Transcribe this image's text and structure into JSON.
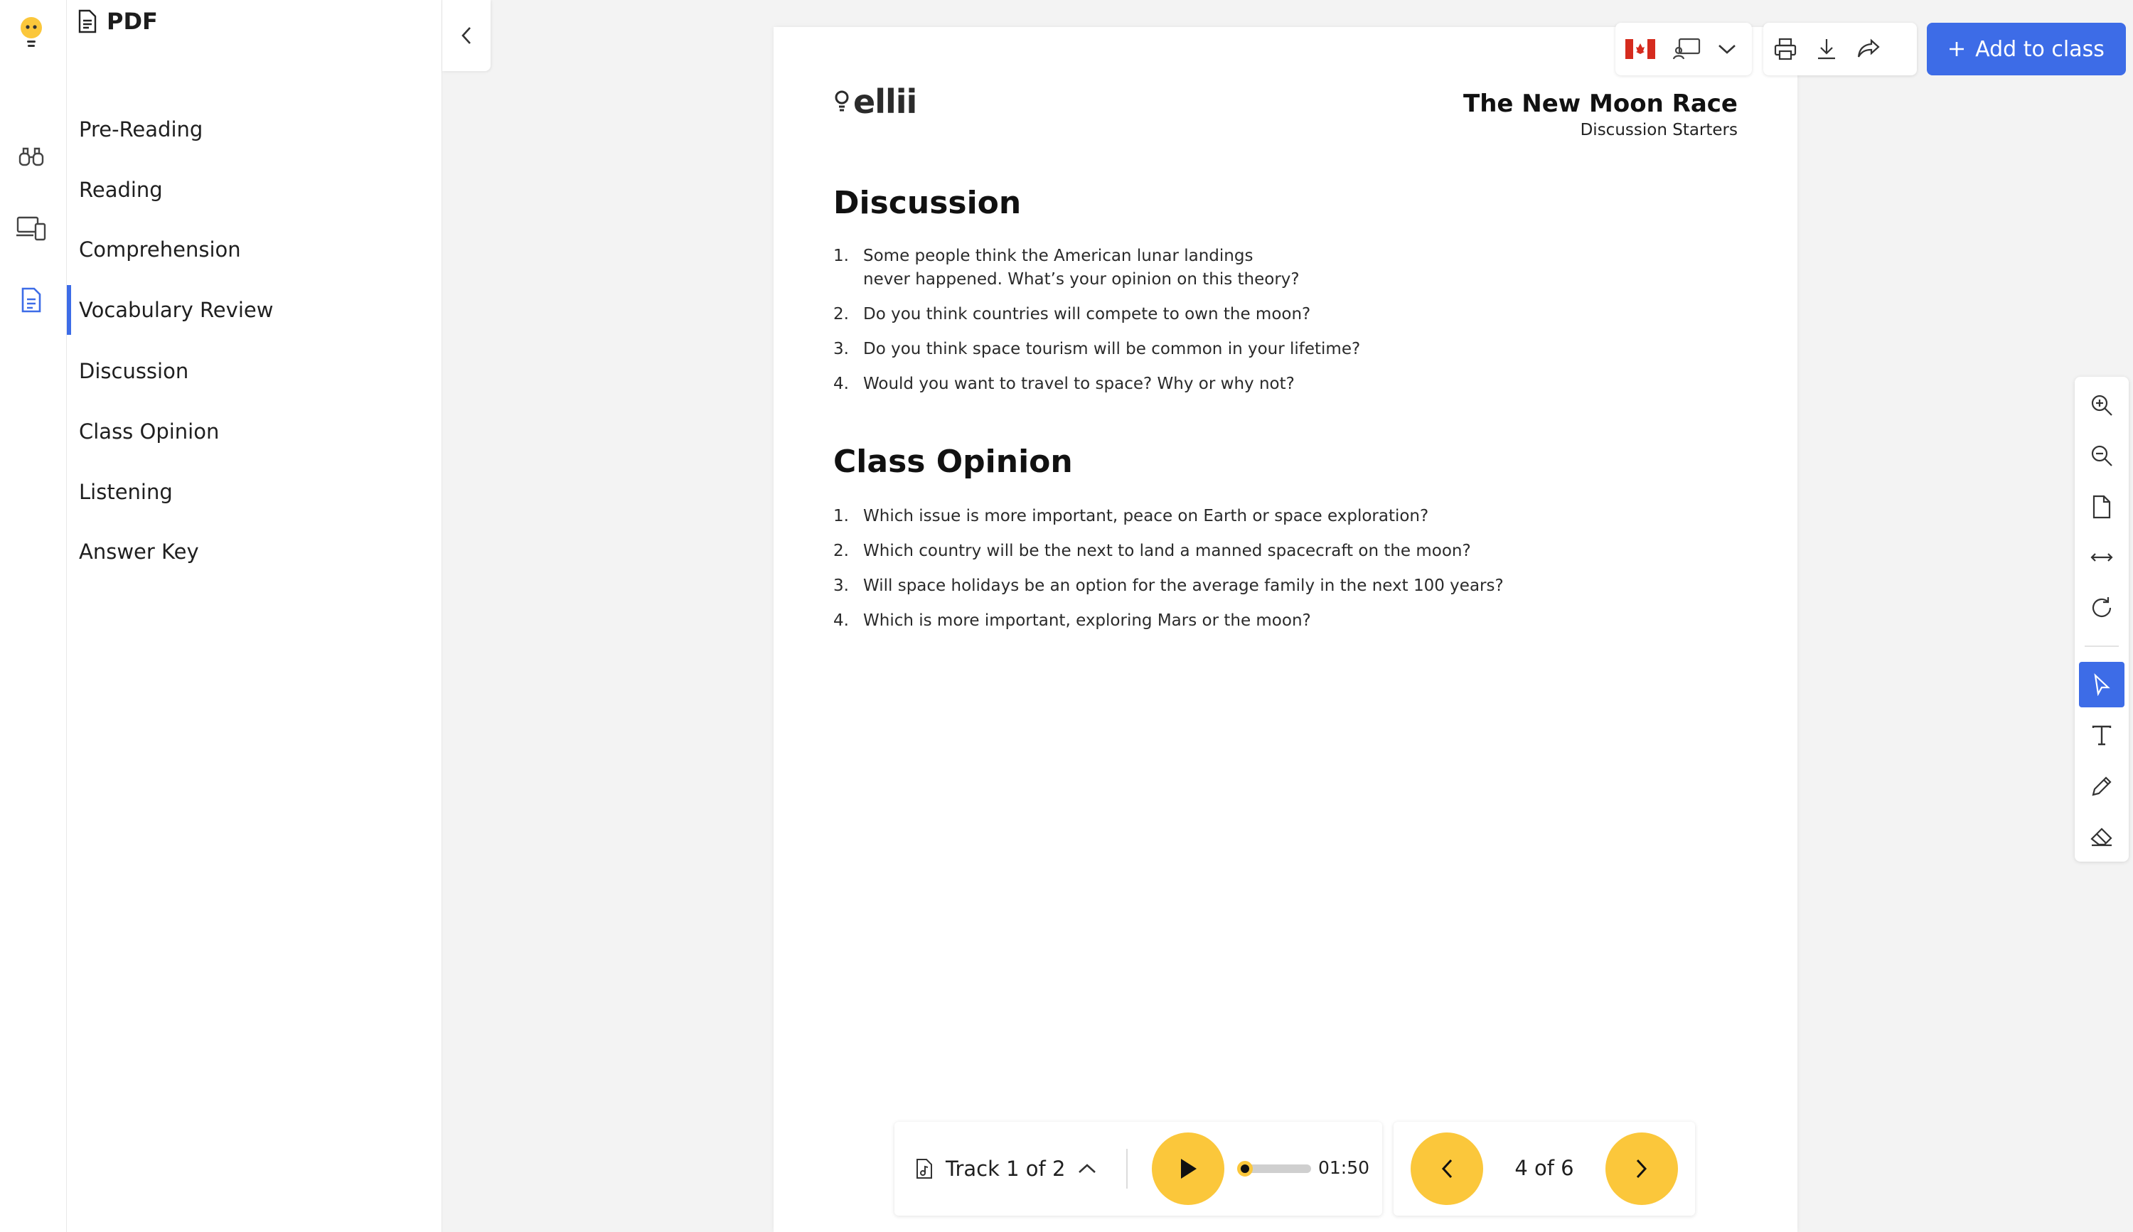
{
  "app": {
    "accent_color": "#3d6ce7",
    "brand_yellow": "#fbc73b"
  },
  "rail": {
    "icons": [
      "lightbulb-logo-icon",
      "binoculars-icon",
      "devices-icon",
      "document-icon"
    ]
  },
  "nav": {
    "title": "PDF",
    "items": [
      {
        "label": "Pre-Reading",
        "active": false
      },
      {
        "label": "Reading",
        "active": false
      },
      {
        "label": "Comprehension",
        "active": false
      },
      {
        "label": "Vocabulary Review",
        "active": true
      },
      {
        "label": "Discussion",
        "active": false
      },
      {
        "label": "Class Opinion",
        "active": false
      },
      {
        "label": "Listening",
        "active": false
      },
      {
        "label": "Answer Key",
        "active": false
      }
    ]
  },
  "toolbar": {
    "add_label": "Add to class"
  },
  "document": {
    "logo": "ellii",
    "title": "The New Moon Race",
    "subtitle": "Discussion Starters",
    "sections": [
      {
        "heading": "Discussion",
        "questions": [
          {
            "num": "1.",
            "line1": "Some people think the American lunar landings",
            "line2": "never happened. What’s your opinion on this theory?"
          },
          {
            "num": "2.",
            "line1": "Do you think countries will compete to own the moon?"
          },
          {
            "num": "3.",
            "line1": "Do you think space tourism will be common in your lifetime?"
          },
          {
            "num": "4.",
            "line1": "Would you want to travel to space? Why or why not?"
          }
        ]
      },
      {
        "heading": "Class Opinion",
        "questions": [
          {
            "num": "1.",
            "line1": "Which issue is more important, peace on Earth or space exploration?"
          },
          {
            "num": "2.",
            "line1": "Which country will be the next to land a manned spacecraft on the moon?"
          },
          {
            "num": "3.",
            "line1": "Will space holidays be an option for the average family in the next 100 years?"
          },
          {
            "num": "4.",
            "line1": "Which is more important, exploring Mars or the moon?"
          }
        ]
      }
    ]
  },
  "player": {
    "track_label": "Track 1 of 2",
    "time": "01:50",
    "progress": 0.05
  },
  "pager": {
    "label": "4 of 6"
  }
}
